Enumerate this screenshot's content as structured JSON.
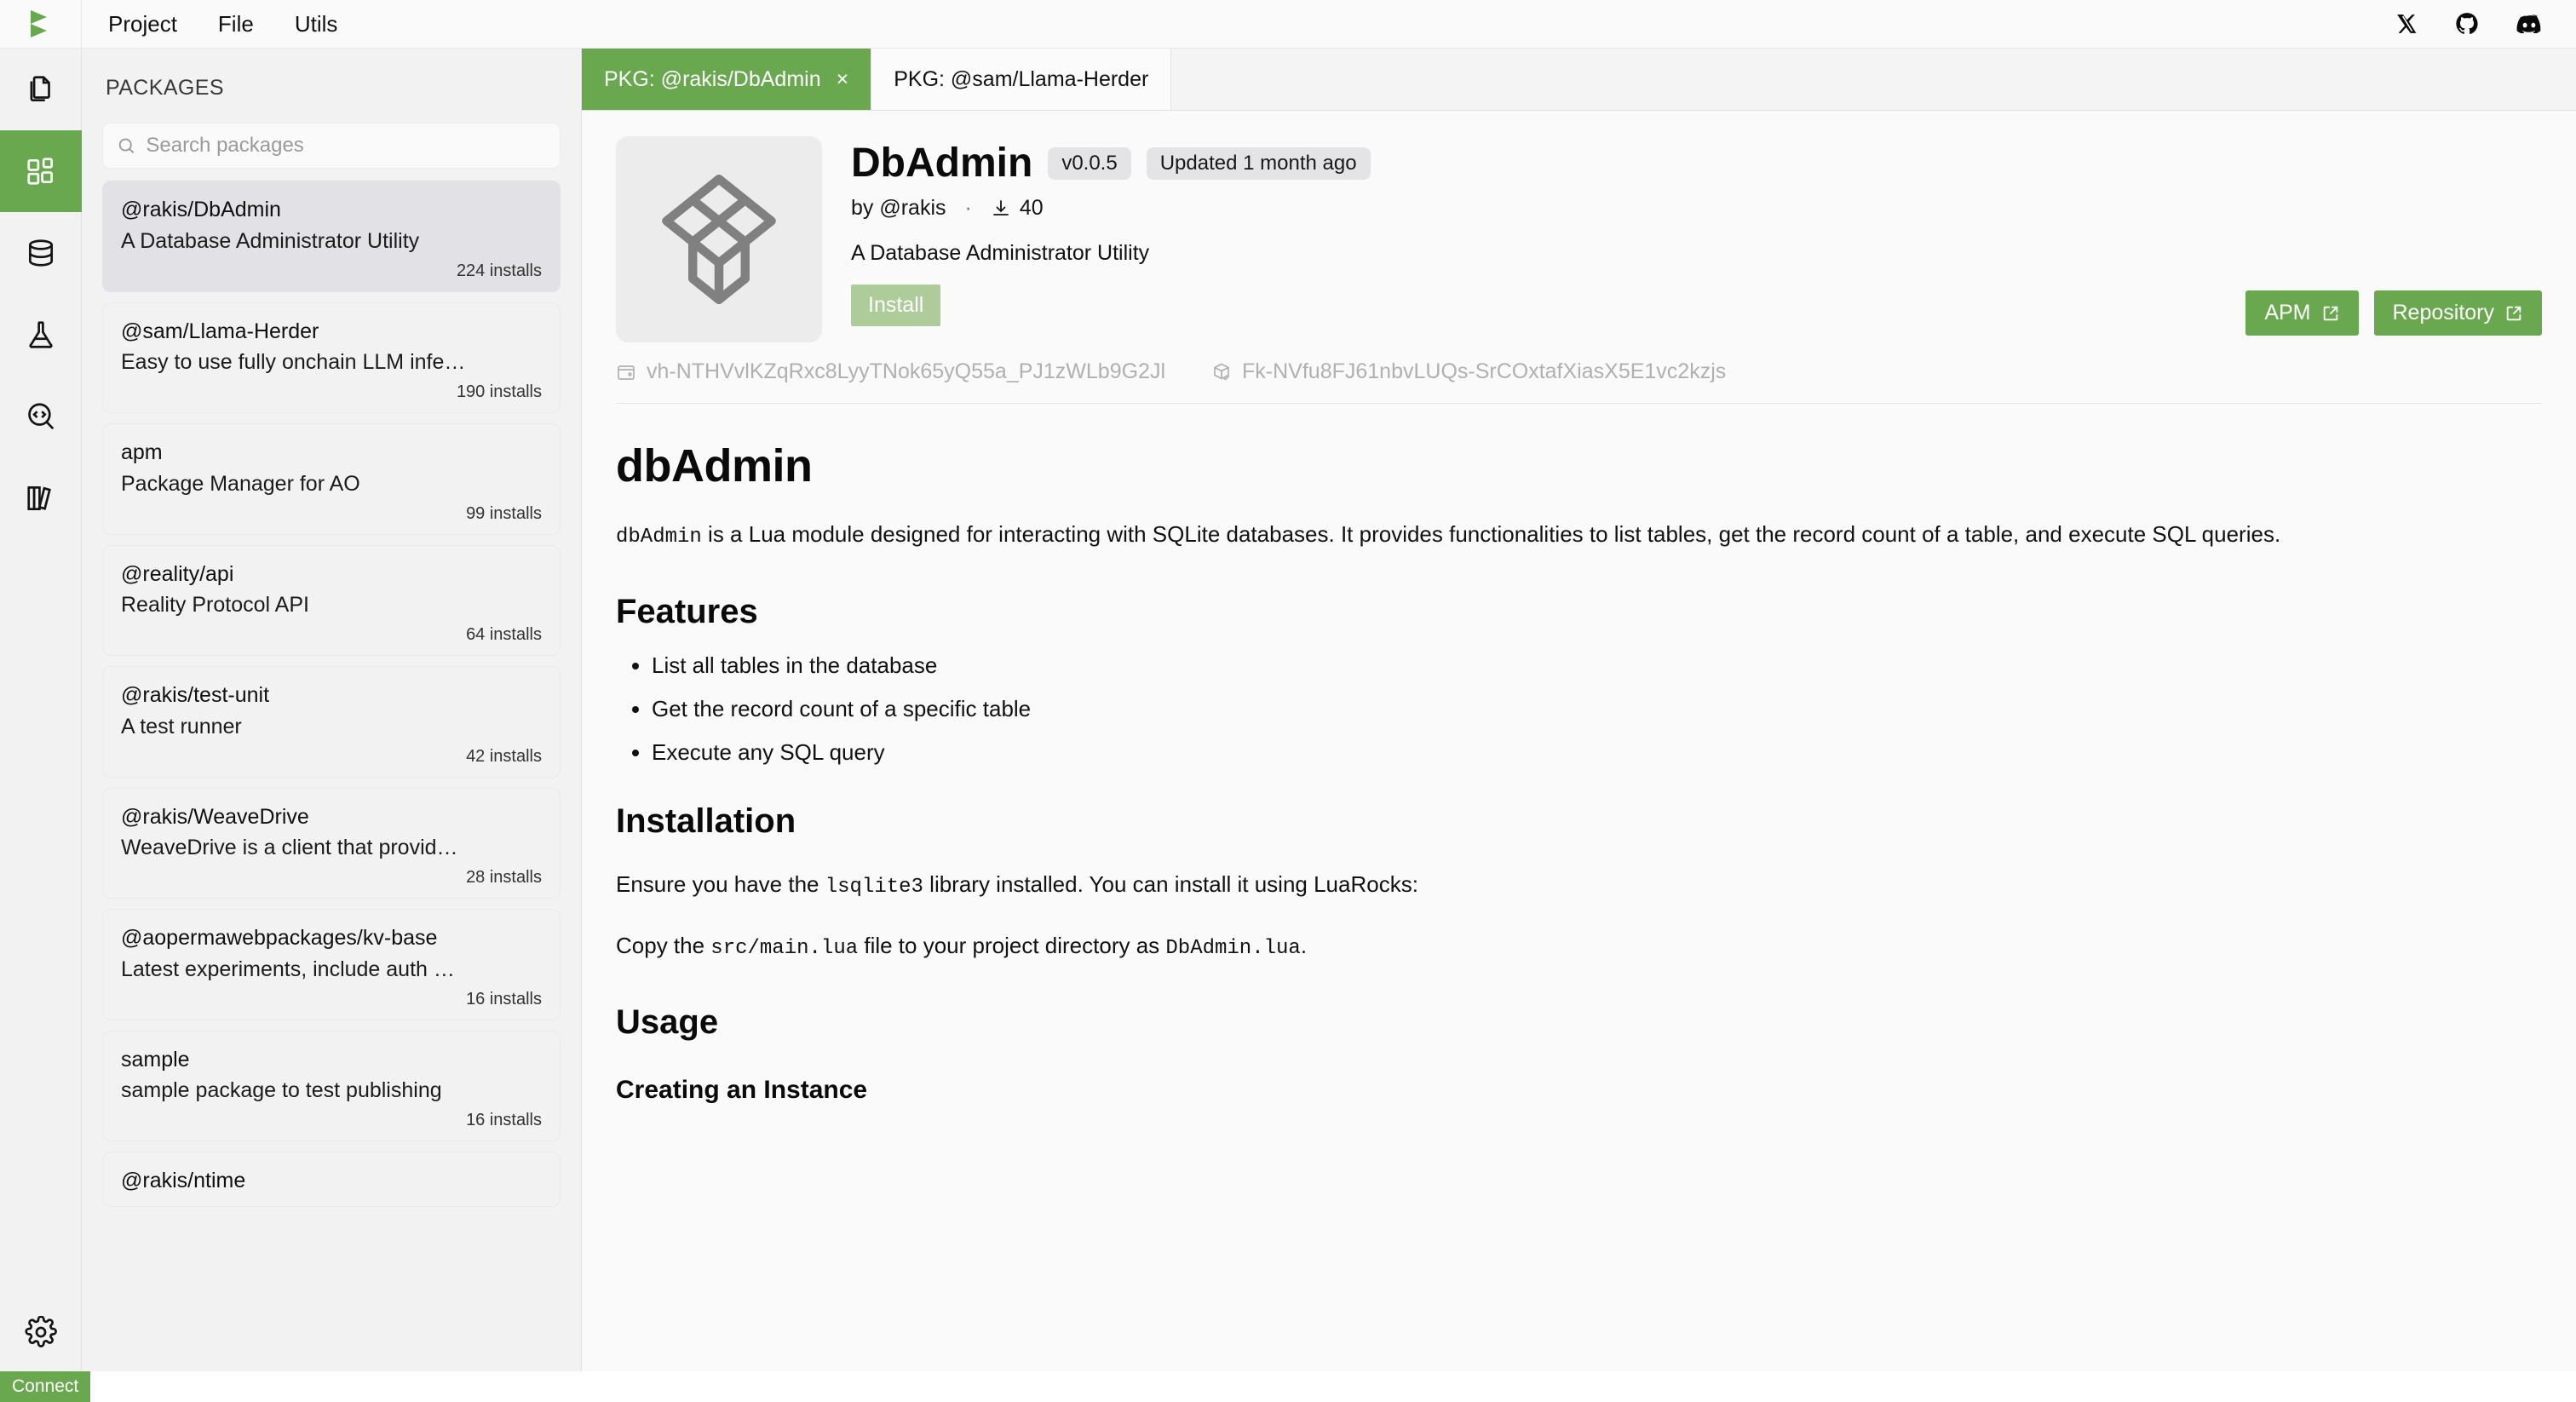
{
  "menubar": {
    "logo_icon": "play-logo-icon",
    "items": [
      {
        "label": "Project"
      },
      {
        "label": "File"
      },
      {
        "label": "Utils"
      }
    ],
    "social": [
      {
        "name": "x-twitter-icon"
      },
      {
        "name": "github-icon"
      },
      {
        "name": "discord-icon"
      }
    ]
  },
  "activity_bar": {
    "items": [
      {
        "name": "files-icon",
        "active": false
      },
      {
        "name": "packages-icon",
        "active": true
      },
      {
        "name": "database-icon",
        "active": false
      },
      {
        "name": "flask-icon",
        "active": false
      },
      {
        "name": "code-search-icon",
        "active": false
      },
      {
        "name": "library-icon",
        "active": false
      }
    ],
    "bottom": {
      "name": "settings-gear-icon"
    }
  },
  "sidebar": {
    "title": "PACKAGES",
    "search": {
      "placeholder": "Search packages",
      "value": ""
    },
    "packages": [
      {
        "name": "@rakis/DbAdmin",
        "desc": "A Database Administrator Utility",
        "installs": "224 installs",
        "selected": true
      },
      {
        "name": "@sam/Llama-Herder",
        "desc": "Easy to use fully onchain LLM infe…",
        "installs": "190 installs",
        "selected": false
      },
      {
        "name": "apm",
        "desc": "Package Manager for AO",
        "installs": "99 installs",
        "selected": false
      },
      {
        "name": "@reality/api",
        "desc": "Reality Protocol API",
        "installs": "64 installs",
        "selected": false
      },
      {
        "name": "@rakis/test-unit",
        "desc": "A test runner",
        "installs": "42 installs",
        "selected": false
      },
      {
        "name": "@rakis/WeaveDrive",
        "desc": "WeaveDrive is a client that provid…",
        "installs": "28 installs",
        "selected": false
      },
      {
        "name": "@aopermawebpackages/kv-base",
        "desc": "Latest experiments, include auth …",
        "installs": "16 installs",
        "selected": false
      },
      {
        "name": "sample",
        "desc": "sample package to test publishing",
        "installs": "16 installs",
        "selected": false
      },
      {
        "name": "@rakis/ntime",
        "desc": "",
        "installs": "",
        "selected": false
      }
    ]
  },
  "tabs": [
    {
      "label": "PKG: @rakis/DbAdmin",
      "active": true,
      "closable": true,
      "close_glyph": "×"
    },
    {
      "label": "PKG: @sam/Llama-Herder",
      "active": false,
      "closable": false,
      "close_glyph": ""
    }
  ],
  "package": {
    "logo_icon": "package-cube-icon",
    "title": "DbAdmin",
    "version_badge": "v0.0.5",
    "updated_badge": "Updated 1 month ago",
    "author": "by @rakis",
    "separator": "·",
    "downloads": "40",
    "download_icon": "download-icon",
    "summary": "A Database Administrator Utility",
    "install_label": "Install",
    "apm_label": "APM",
    "repository_label": "Repository",
    "external_icon": "external-link-icon",
    "tx_ids": [
      {
        "icon": "wallet-icon",
        "value": "vh-NTHVvlKZqRxc8LyyTNok65yQ55a_PJ1zWLb9G2Jl"
      },
      {
        "icon": "package-check-icon",
        "value": "Fk-NVfu8FJ61nbvLUQs-SrCOxtafXiasX5E1vc2kzjs"
      }
    ]
  },
  "readme": {
    "h1": "dbAdmin",
    "intro_code": "dbAdmin",
    "intro_rest": " is a Lua module designed for interacting with SQLite databases. It provides functionalities to list tables, get the record count of a table, and execute SQL queries.",
    "features_heading": "Features",
    "features": [
      "List all tables in the database",
      "Get the record count of a specific table",
      "Execute any SQL query"
    ],
    "installation_heading": "Installation",
    "install_p1_a": "Ensure you have the ",
    "install_p1_code": "lsqlite3",
    "install_p1_b": " library installed. You can install it using LuaRocks:",
    "install_p2_a": "Copy the ",
    "install_p2_code1": "src/main.lua",
    "install_p2_b": " file to your project directory as ",
    "install_p2_code2": "DbAdmin.lua",
    "install_p2_c": ".",
    "usage_heading": "Usage",
    "creating_heading": "Creating an Instance"
  },
  "statusbar": {
    "connect_label": "Connect"
  },
  "colors": {
    "accent_green": "#6aa84f",
    "install_disabled_green": "#aecb9a",
    "sidebar_bg": "#f2f2f2",
    "selected_item": "#e1e1e6",
    "badge_bg": "#e4e4e7"
  }
}
